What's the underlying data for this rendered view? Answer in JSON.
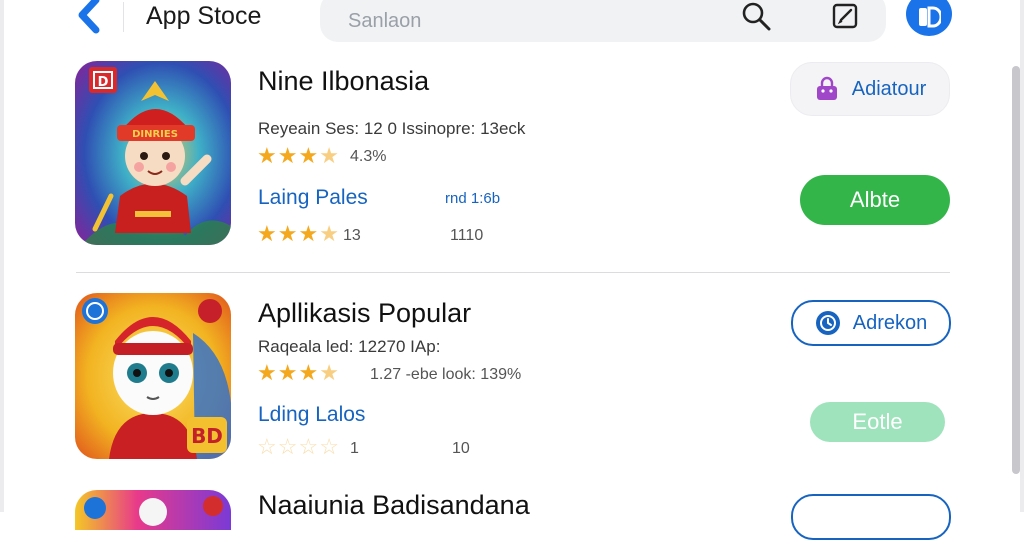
{
  "header": {
    "title": "App Stoce",
    "search_placeholder": "Sanlaon"
  },
  "apps": [
    {
      "name": "Nine Ilbonasia",
      "meta": "Reyeain Ses: 12 0 Issinopre: 13eck",
      "rating_value": 3.5,
      "rating_text": "4.3%",
      "link_label": "Laing Pales",
      "link_detail": "rnd 1:6b",
      "secondary_rating_value": 3.5,
      "secondary_count": "13",
      "secondary_num": "1110",
      "action_label": "Adiatour",
      "primary_label": "Albte",
      "icon_badge": "D",
      "hat_text": "DINRIES"
    },
    {
      "name": "Apllikasis Popular",
      "meta": "Raqeala led: 12270 IAp:",
      "rating_value": 3.5,
      "rating_text": "1.27 -ebe look: 139%",
      "link_label": "Lding Lalos",
      "secondary_rating_value": 0,
      "secondary_count": "1",
      "secondary_num": "10",
      "action_label": "Adrekon",
      "primary_label": "Eotle",
      "icon_badge": "BD"
    },
    {
      "name": "Naaiunia Badisandana"
    }
  ],
  "colors": {
    "accent_blue": "#1764c0",
    "green_button": "#34b54a",
    "mint_button": "#9ee3bc",
    "star": "#f4a81d"
  },
  "icons": [
    "back-chevron-icon",
    "search-icon",
    "edit-icon",
    "profile-icon",
    "bag-icon",
    "clock-icon"
  ]
}
